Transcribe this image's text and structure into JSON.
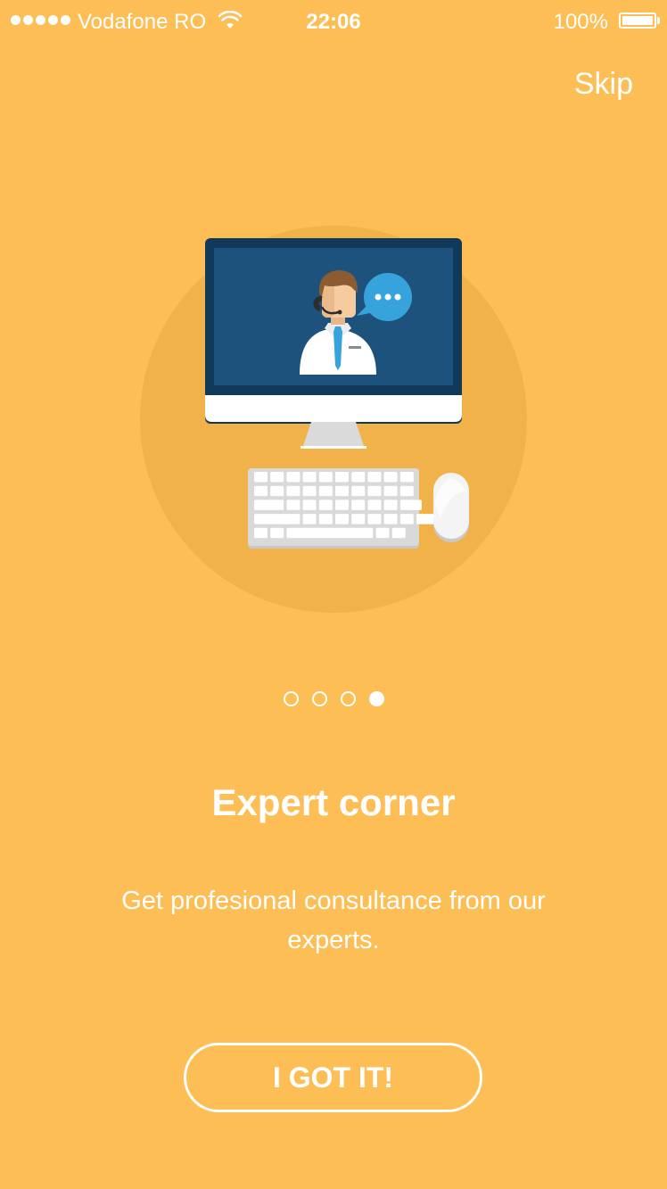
{
  "status_bar": {
    "carrier": "Vodafone RO",
    "time": "22:06",
    "battery": "100%"
  },
  "header": {
    "skip_label": "Skip"
  },
  "illustration": {
    "icon": "support-agent-desktop-icon",
    "chat_bubble": "•••"
  },
  "pager": {
    "total": 4,
    "active_index": 3
  },
  "content": {
    "title": "Expert corner",
    "description": "Get profesional consultance from our experts."
  },
  "actions": {
    "confirm_label": "I GOT IT!"
  },
  "colors": {
    "background": "#FDBE55",
    "circle": "#F2B24A",
    "screen": "#1C527B",
    "monitor_frame": "#103A5A",
    "chat_bubble": "#36A3DC"
  }
}
